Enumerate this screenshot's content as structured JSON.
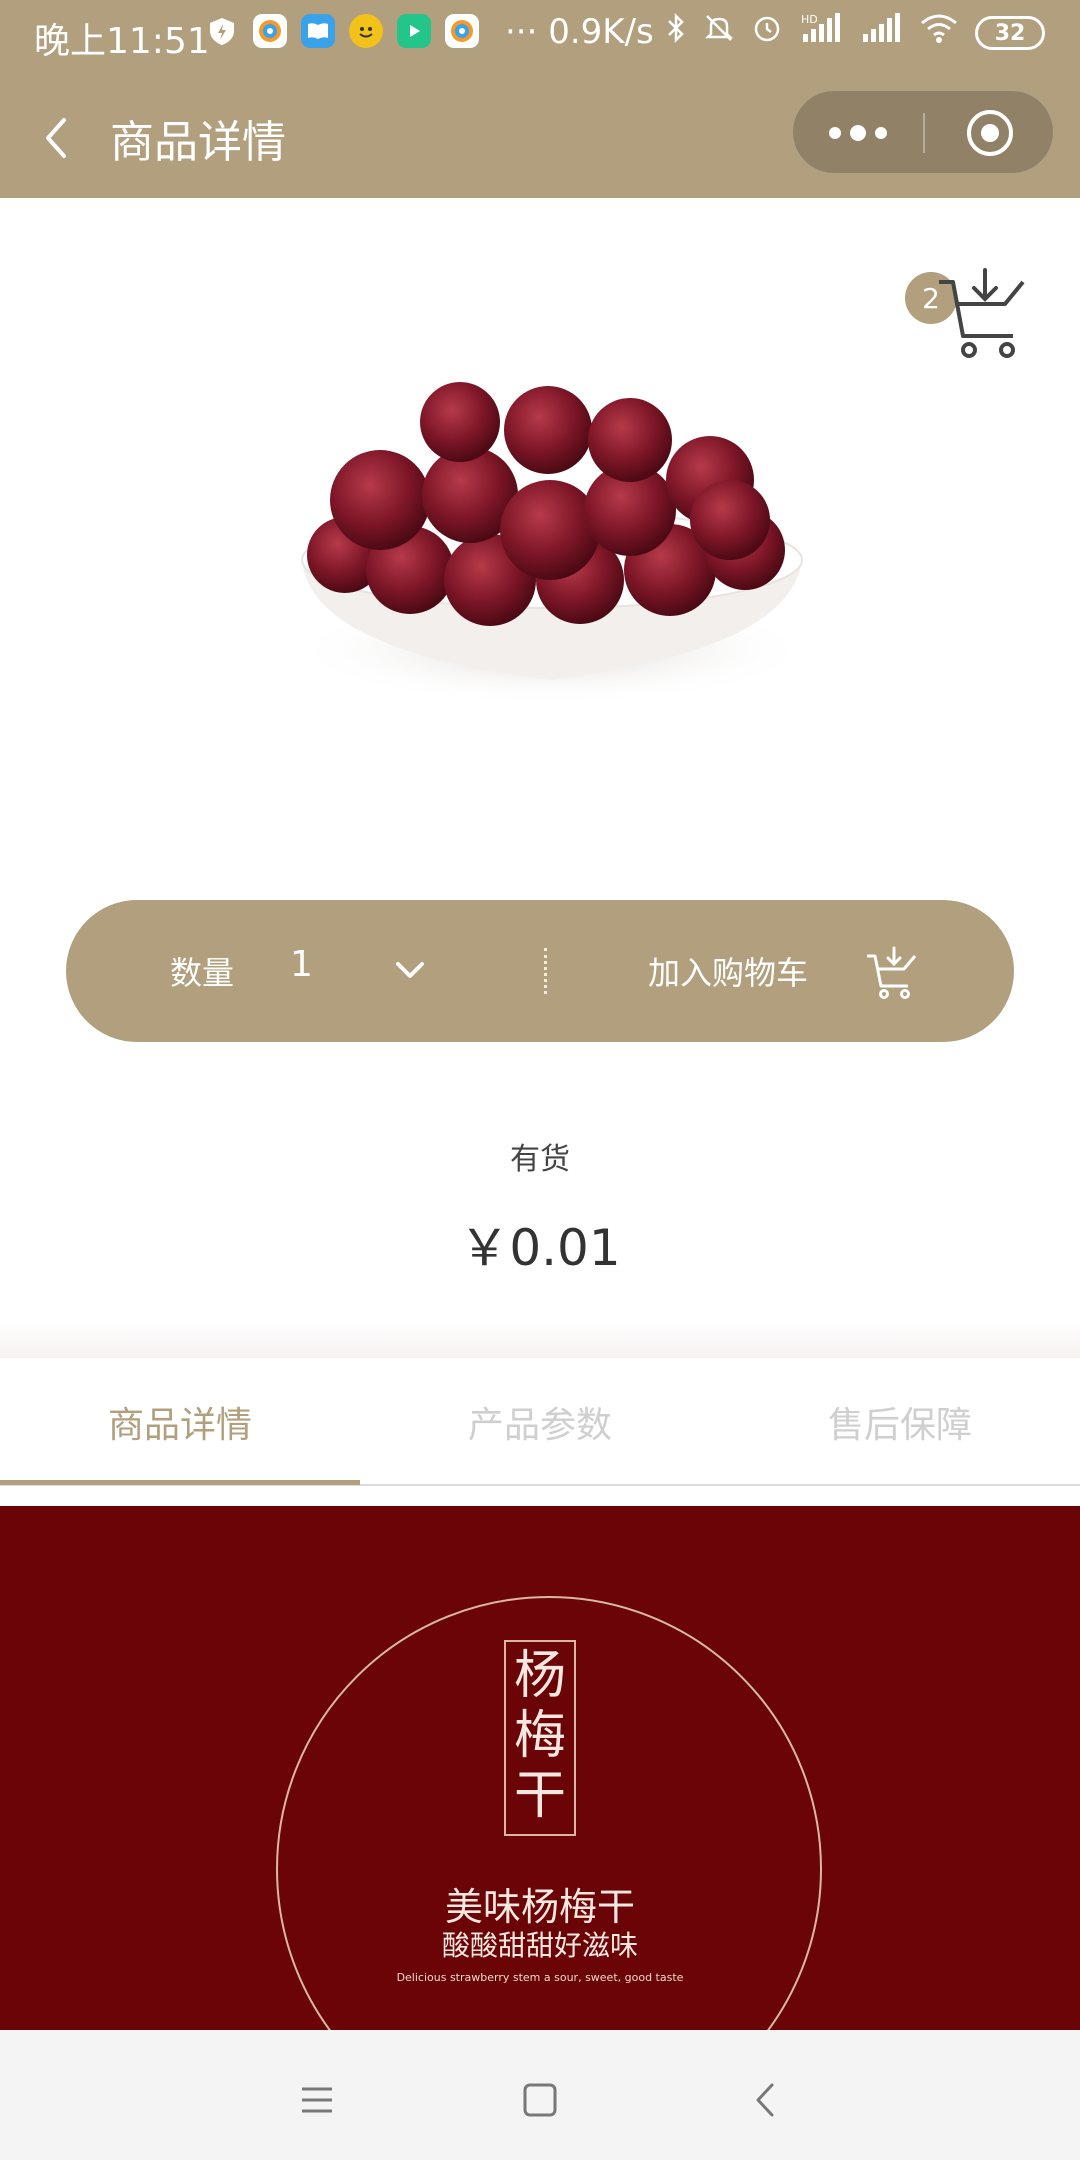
{
  "status_bar": {
    "time": "晚上11:51",
    "speed": "··· 0.9K/s",
    "signal_text": "HD",
    "battery": "32",
    "app_icons": [
      "shield-icon",
      "browser-icon",
      "book-icon",
      "emoji-icon",
      "video-icon",
      "browser-icon"
    ]
  },
  "header": {
    "title": "商品详情"
  },
  "cart": {
    "badge_count": "2"
  },
  "action_bar": {
    "quantity_label": "数量",
    "quantity_value": "1",
    "add_to_cart_label": "加入购物车"
  },
  "product": {
    "stock_status": "有货",
    "price": "￥0.01"
  },
  "tabs": [
    {
      "label": "商品详情",
      "active": true
    },
    {
      "label": "产品参数",
      "active": false
    },
    {
      "label": "售后保障",
      "active": false
    }
  ],
  "banner": {
    "title_chars": [
      "杨",
      "梅",
      "干"
    ],
    "line1": "美味杨梅干",
    "line2": "酸酸甜甜好滋味",
    "line3": "Delicious strawberry stem a sour, sweet, good taste"
  },
  "colors": {
    "brand_gold": "#b19f7e",
    "banner_red": "#6b0406",
    "tab_inactive": "#cfcfcf"
  }
}
